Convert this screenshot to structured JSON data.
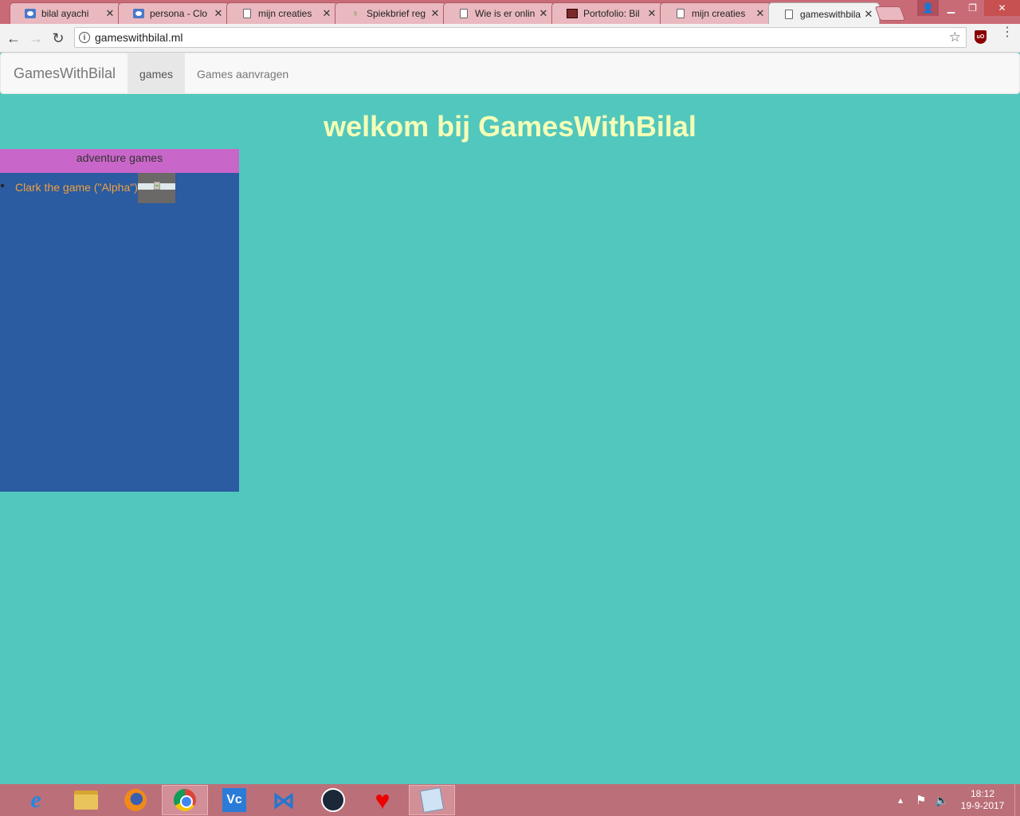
{
  "browser": {
    "tabs": [
      {
        "title": "bilal ayachi",
        "icon": "cloud-icon",
        "active": false
      },
      {
        "title": "persona - Clo",
        "icon": "cloud-icon",
        "active": false
      },
      {
        "title": "mijn creaties",
        "icon": "document-icon",
        "active": false
      },
      {
        "title": "Spiekbrief reg",
        "icon": "leaf-icon",
        "active": false
      },
      {
        "title": "Wie is er onlin",
        "icon": "document-icon",
        "active": false
      },
      {
        "title": "Portofolio: Bil",
        "icon": "portfolio-icon",
        "active": false
      },
      {
        "title": "mijn creaties",
        "icon": "document-icon",
        "active": false
      },
      {
        "title": "gameswithbila",
        "icon": "document-icon",
        "active": true
      }
    ],
    "url": "gameswithbilal.ml"
  },
  "navbar": {
    "brand": "GamesWithBilal",
    "links": [
      {
        "label": "games",
        "active": true
      },
      {
        "label": "Games aanvragen",
        "active": false
      }
    ]
  },
  "main": {
    "title": "welkom bij GamesWithBilal",
    "panel": {
      "header": "adventure games",
      "games": [
        {
          "label": "Clark the game (\"Alpha\")"
        }
      ]
    }
  },
  "taskbar": {
    "apps": [
      "internet-explorer-icon",
      "file-explorer-icon",
      "firefox-icon",
      "chrome-icon",
      "vc-icon",
      "visual-studio-icon",
      "steam-icon",
      "heart-icon",
      "notepad-icon"
    ],
    "clock_time": "18:12",
    "clock_date": "19-9-2017"
  },
  "colors": {
    "page_background": "#52c7bd",
    "title_text": "#f5ffb7",
    "panel_background": "#2b5ba0",
    "panel_header": "#c966c9",
    "game_link": "#f0a040",
    "chrome_frame": "#c96b77"
  }
}
